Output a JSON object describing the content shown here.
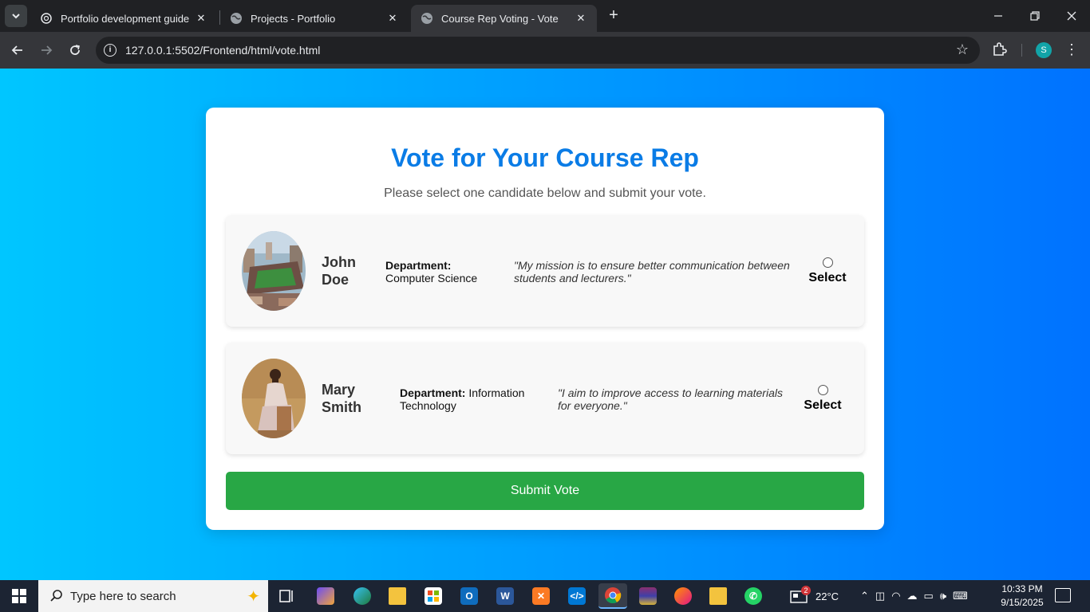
{
  "browser": {
    "tabs": [
      {
        "title": "Portfolio development guide",
        "favicon": "openai-icon"
      },
      {
        "title": "Projects - Portfolio",
        "favicon": "globe-icon"
      },
      {
        "title": "Course Rep Voting - Vote",
        "favicon": "globe-icon",
        "active": true
      }
    ],
    "url": "127.0.0.1:5502/Frontend/html/vote.html",
    "profile_initial": "S"
  },
  "page": {
    "title": "Vote for Your Course Rep",
    "subtitle": "Please select one candidate below and submit your vote.",
    "candidates": [
      {
        "name": "John Doe",
        "department_label": "Department:",
        "department": "Computer Science",
        "quote": "\"My mission is to ensure better communication between students and lecturers.\"",
        "select_label": "Select",
        "selected": false
      },
      {
        "name": "Mary Smith",
        "department_label": "Department:",
        "department": "Information Technology",
        "quote": "\"I aim to improve access to learning materials for everyone.\"",
        "select_label": "Select",
        "selected": false
      }
    ],
    "submit_label": "Submit Vote",
    "colors": {
      "gradient_start": "#00c6ff",
      "gradient_end": "#0072ff",
      "title": "#0a7ce6",
      "submit": "#28a745"
    }
  },
  "taskbar": {
    "search_placeholder": "Type here to search",
    "weather": "22°C",
    "weather_badge": "2",
    "time": "10:33 PM",
    "date": "9/15/2025"
  }
}
